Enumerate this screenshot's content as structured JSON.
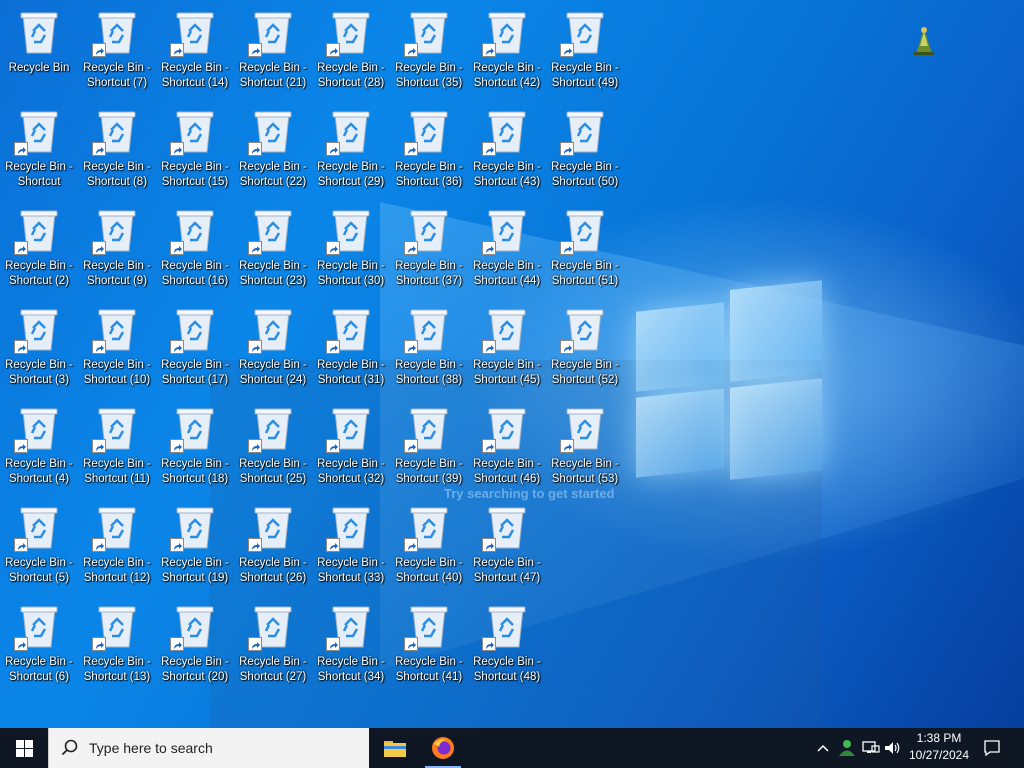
{
  "colors": {
    "accent": "#0a86e8",
    "taskbar": "#0f1724",
    "search_bg": "#f3f3f3"
  },
  "desktop": {
    "ghost_text": "Try searching to get started",
    "columns": [
      [
        "Recycle Bin",
        "Recycle Bin - Shortcut",
        "Recycle Bin - Shortcut (2)",
        "Recycle Bin - Shortcut (3)",
        "Recycle Bin - Shortcut (4)",
        "Recycle Bin - Shortcut (5)",
        "Recycle Bin - Shortcut (6)"
      ],
      [
        "Recycle Bin - Shortcut (7)",
        "Recycle Bin - Shortcut (8)",
        "Recycle Bin - Shortcut (9)",
        "Recycle Bin - Shortcut (10)",
        "Recycle Bin - Shortcut (11)",
        "Recycle Bin - Shortcut (12)",
        "Recycle Bin - Shortcut (13)"
      ],
      [
        "Recycle Bin - Shortcut (14)",
        "Recycle Bin - Shortcut (15)",
        "Recycle Bin - Shortcut (16)",
        "Recycle Bin - Shortcut (17)",
        "Recycle Bin - Shortcut (18)",
        "Recycle Bin - Shortcut (19)",
        "Recycle Bin - Shortcut (20)"
      ],
      [
        "Recycle Bin - Shortcut (21)",
        "Recycle Bin - Shortcut (22)",
        "Recycle Bin - Shortcut (23)",
        "Recycle Bin - Shortcut (24)",
        "Recycle Bin - Shortcut (25)",
        "Recycle Bin - Shortcut (26)",
        "Recycle Bin - Shortcut (27)"
      ],
      [
        "Recycle Bin - Shortcut (28)",
        "Recycle Bin - Shortcut (29)",
        "Recycle Bin - Shortcut (30)",
        "Recycle Bin - Shortcut (31)",
        "Recycle Bin - Shortcut (32)",
        "Recycle Bin - Shortcut (33)",
        "Recycle Bin - Shortcut (34)"
      ],
      [
        "Recycle Bin - Shortcut (35)",
        "Recycle Bin - Shortcut (36)",
        "Recycle Bin - Shortcut (37)",
        "Recycle Bin - Shortcut (38)",
        "Recycle Bin - Shortcut (39)",
        "Recycle Bin - Shortcut (40)",
        "Recycle Bin - Shortcut (41)"
      ],
      [
        "Recycle Bin - Shortcut (42)",
        "Recycle Bin - Shortcut (43)",
        "Recycle Bin - Shortcut (44)",
        "Recycle Bin - Shortcut (45)",
        "Recycle Bin - Shortcut (46)",
        "Recycle Bin - Shortcut (47)",
        "Recycle Bin - Shortcut (48)"
      ],
      [
        "Recycle Bin - Shortcut (49)",
        "Recycle Bin - Shortcut (50)",
        "Recycle Bin - Shortcut (51)",
        "Recycle Bin - Shortcut (52)",
        "Recycle Bin - Shortcut (53)"
      ]
    ]
  },
  "taskbar": {
    "start_icon": "windows-logo-icon",
    "search_placeholder": "Type here to search",
    "apps": [
      {
        "name": "file-explorer",
        "icon": "folder-icon"
      },
      {
        "name": "firefox",
        "icon": "firefox-icon"
      }
    ],
    "tray_icons": [
      "chevron-up-icon",
      "network-user-icon",
      "network-icon",
      "volume-icon"
    ],
    "clock_time": "1:38 PM",
    "clock_date": "10/27/2024",
    "notifications_icon": "notification-icon"
  }
}
